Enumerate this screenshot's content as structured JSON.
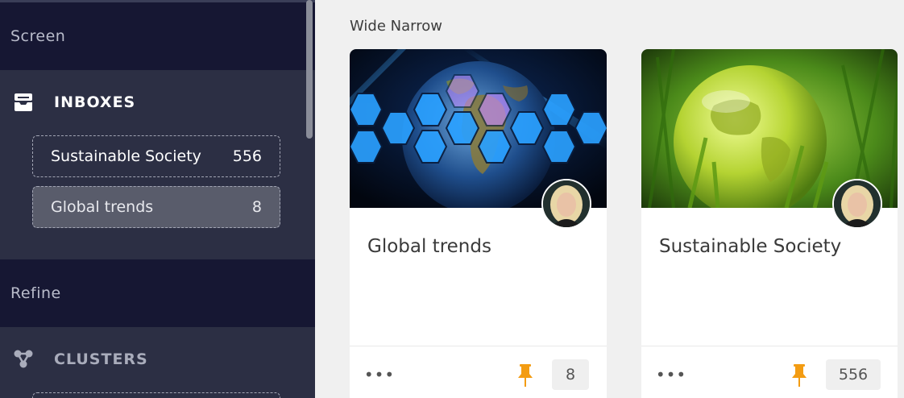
{
  "sidebar": {
    "sections": {
      "screen_label": "Screen",
      "refine_label": "Refine"
    },
    "inboxes": {
      "label": "INBOXES",
      "icon": "inbox-tray-icon",
      "items": [
        {
          "label": "Sustainable Society",
          "count": "556"
        },
        {
          "label": "Global trends",
          "count": "8",
          "selected": true
        }
      ]
    },
    "clusters": {
      "label": "CLUSTERS",
      "icon": "cluster-nodes-icon"
    }
  },
  "main": {
    "layout_title": "Wide Narrow",
    "cards": [
      {
        "title": "Global trends",
        "count": "8",
        "more_label": "•••",
        "image": "globe-hexagons-image",
        "avatar": "user-avatar"
      },
      {
        "title": "Sustainable Society",
        "count": "556",
        "more_label": "•••",
        "image": "glass-globe-grass-image",
        "avatar": "user-avatar"
      }
    ]
  },
  "colors": {
    "section_header_bg": "#161733",
    "sidebar_bg": "#2c2f44",
    "selected_item_bg": "#595c6b",
    "pin_accent": "#f39c12",
    "main_bg": "#f0f0f0"
  }
}
